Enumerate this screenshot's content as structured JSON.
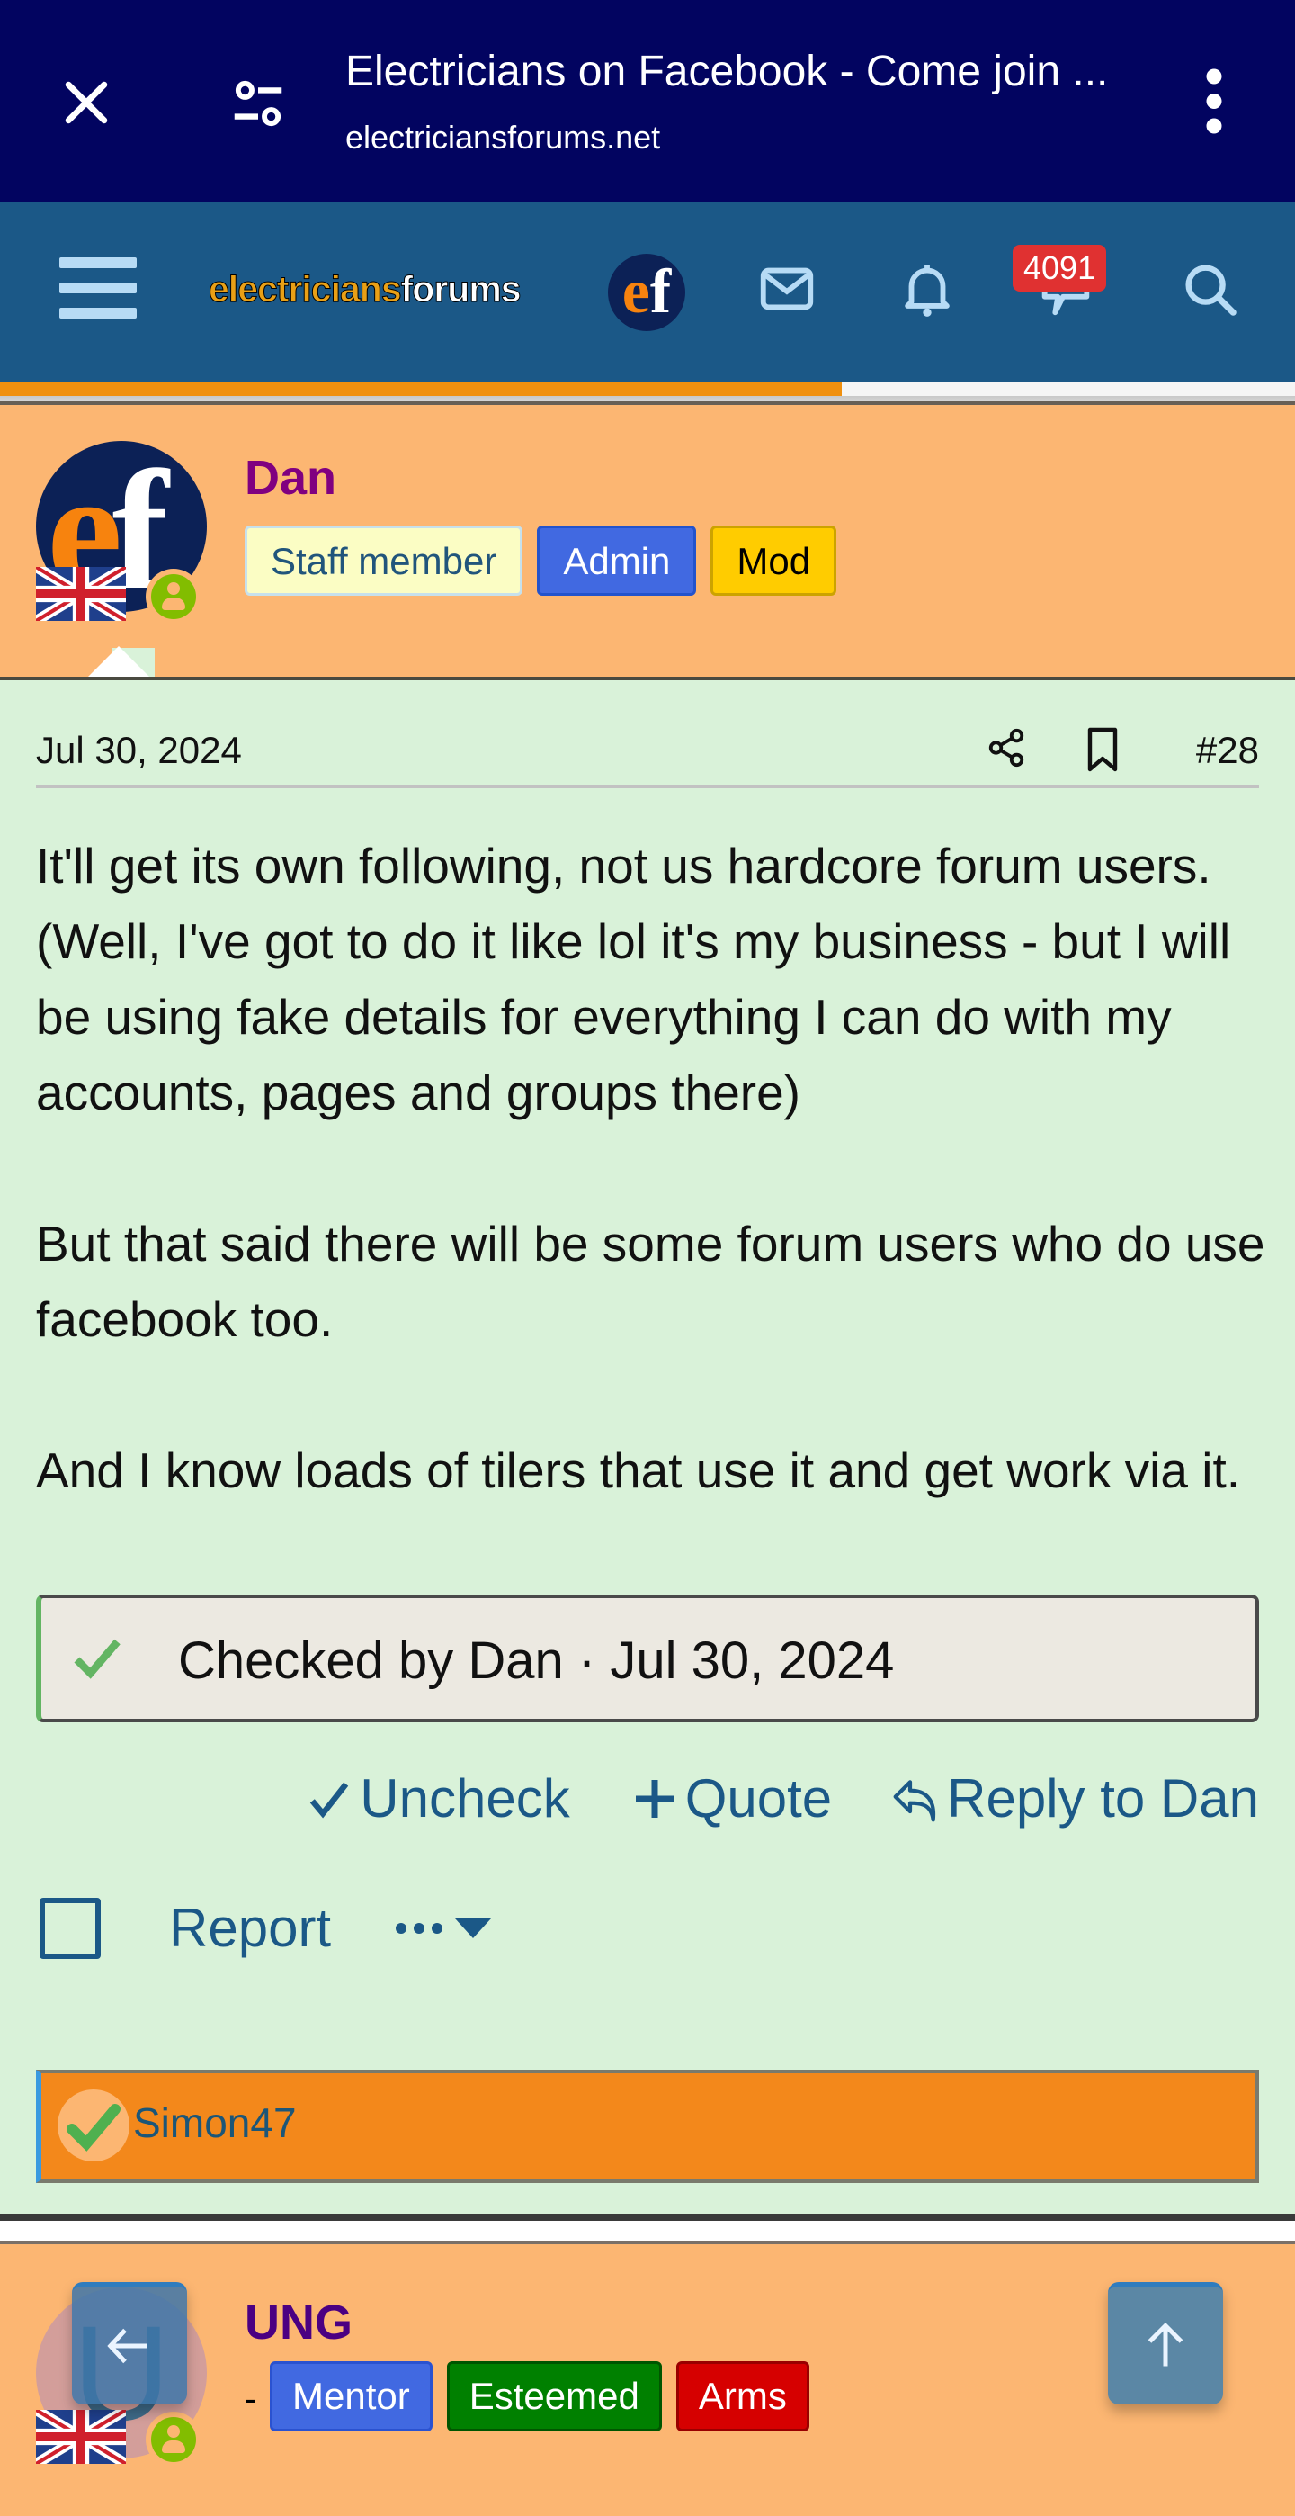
{
  "browser": {
    "title": "Electricians on Facebook - Come join ...",
    "url": "electriciansforums.net",
    "close_icon": "close-icon",
    "tune_icon": "page-settings-icon",
    "menu_icon": "more-vert-icon"
  },
  "header": {
    "logo_part1": "electricians",
    "logo_part2": "forums",
    "mini_logo_e": "e",
    "mini_logo_f": "f",
    "notification_count": "4091",
    "icons": [
      "menu-icon",
      "inbox-icon",
      "bell-icon",
      "whats-new-icon",
      "search-icon"
    ],
    "scroll_progress_percent": 65,
    "colors": {
      "bar": "#1b5887",
      "progress": "#f0900f",
      "badge": "#e03131"
    }
  },
  "post": {
    "author": {
      "name": "Dan",
      "avatar_e": "e",
      "avatar_f": "f",
      "badges": [
        "Staff member",
        "Admin",
        "Mod"
      ],
      "country": "United Kingdom",
      "online": true
    },
    "date": "Jul 30, 2024",
    "number": "#28",
    "paragraphs": [
      "It'll get its own following, not us hardcore forum users. (Well, I've got to do it like lol it's my business - but I will be using fake details for everything I can do with my accounts, pages and groups there)",
      "But that said there will be some forum users who do use facebook too.",
      "And I know loads of tilers that use it and get work via it."
    ],
    "checked_note": "Checked by Dan · Jul 30, 2024",
    "actions": {
      "uncheck": "Uncheck",
      "quote": "Quote",
      "reply": "Reply to Dan"
    },
    "report": "Report",
    "reactions": {
      "users": "Simon47"
    }
  },
  "next_post": {
    "author": {
      "name": "UNG",
      "avatar_letter": "U",
      "prefix": "-",
      "badges": [
        "Mentor",
        "Esteemed",
        "Arms"
      ],
      "country": "United Kingdom",
      "online": true
    }
  },
  "floating": {
    "back_icon": "arrow-left-icon",
    "top_icon": "arrow-up-icon"
  }
}
